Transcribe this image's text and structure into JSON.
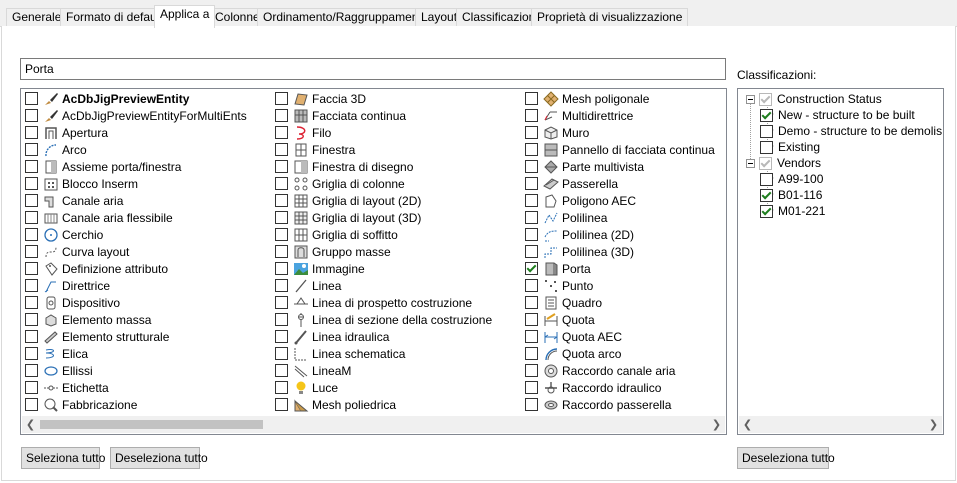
{
  "tabs": [
    {
      "label": "Generale"
    },
    {
      "label": "Formato di default"
    },
    {
      "label": "Applica a"
    },
    {
      "label": "Colonne"
    },
    {
      "label": "Ordinamento/Raggruppamento"
    },
    {
      "label": "Layout"
    },
    {
      "label": "Classificazioni"
    },
    {
      "label": "Proprietà di visualizzazione"
    }
  ],
  "active_tab": "Applica a",
  "search": {
    "value": "Porta"
  },
  "objects": {
    "col1": [
      {
        "label": "AcDbJigPreviewEntity",
        "icon": "brush-icon",
        "checked": false,
        "bold": true
      },
      {
        "label": "AcDbJigPreviewEntityForMultiEnts",
        "icon": "brush-icon",
        "checked": false
      },
      {
        "label": "Apertura",
        "icon": "opening-icon",
        "checked": false
      },
      {
        "label": "Arco",
        "icon": "arc-icon",
        "checked": false
      },
      {
        "label": "Assieme porta/finestra",
        "icon": "door-window-assembly-icon",
        "checked": false
      },
      {
        "label": "Blocco Inserm",
        "icon": "block-icon",
        "checked": false
      },
      {
        "label": "Canale aria",
        "icon": "duct-icon",
        "checked": false
      },
      {
        "label": "Canale aria flessibile",
        "icon": "flex-duct-icon",
        "checked": false
      },
      {
        "label": "Cerchio",
        "icon": "circle-icon",
        "checked": false
      },
      {
        "label": "Curva layout",
        "icon": "layout-curve-icon",
        "checked": false
      },
      {
        "label": "Definizione attributo",
        "icon": "attribute-icon",
        "checked": false
      },
      {
        "label": "Direttrice",
        "icon": "leader-icon",
        "checked": false
      },
      {
        "label": "Dispositivo",
        "icon": "device-icon",
        "checked": false
      },
      {
        "label": "Elemento massa",
        "icon": "mass-element-icon",
        "checked": false
      },
      {
        "label": "Elemento strutturale",
        "icon": "structural-member-icon",
        "checked": false
      },
      {
        "label": "Elica",
        "icon": "helix-icon",
        "checked": false
      },
      {
        "label": "Ellissi",
        "icon": "ellipse-icon",
        "checked": false
      },
      {
        "label": "Etichetta",
        "icon": "label-icon",
        "checked": false
      },
      {
        "label": "Fabbricazione",
        "icon": "fabrication-icon",
        "checked": false
      }
    ],
    "col2": [
      {
        "label": "Faccia 3D",
        "icon": "face3d-icon",
        "checked": false
      },
      {
        "label": "Facciata continua",
        "icon": "curtain-wall-icon",
        "checked": false
      },
      {
        "label": "Filo",
        "icon": "wire-icon",
        "checked": false
      },
      {
        "label": "Finestra",
        "icon": "window-icon",
        "checked": false
      },
      {
        "label": "Finestra di disegno",
        "icon": "viewport-icon",
        "checked": false
      },
      {
        "label": "Griglia di colonne",
        "icon": "column-grid-icon",
        "checked": false
      },
      {
        "label": "Griglia di layout (2D)",
        "icon": "layout-grid-icon",
        "checked": false
      },
      {
        "label": "Griglia di layout (3D)",
        "icon": "layout-grid-3d-icon",
        "checked": false
      },
      {
        "label": "Griglia di soffitto",
        "icon": "ceiling-grid-icon",
        "checked": false
      },
      {
        "label": "Gruppo masse",
        "icon": "mass-group-icon",
        "checked": false
      },
      {
        "label": "Immagine",
        "icon": "image-icon",
        "checked": false
      },
      {
        "label": "Linea",
        "icon": "line-icon",
        "checked": false
      },
      {
        "label": "Linea di prospetto costruzione",
        "icon": "elevation-line-icon",
        "checked": false
      },
      {
        "label": "Linea di sezione della costruzione",
        "icon": "section-line-icon",
        "checked": false
      },
      {
        "label": "Linea idraulica",
        "icon": "pipe-line-icon",
        "checked": false
      },
      {
        "label": "Linea schematica",
        "icon": "schematic-line-icon",
        "checked": false
      },
      {
        "label": "LineaM",
        "icon": "mline-icon",
        "checked": false
      },
      {
        "label": "Luce",
        "icon": "light-icon",
        "checked": false
      },
      {
        "label": "Mesh poliedrica",
        "icon": "polyface-mesh-icon",
        "checked": false
      }
    ],
    "col3": [
      {
        "label": "Mesh poligonale",
        "icon": "polygon-mesh-icon",
        "checked": false
      },
      {
        "label": "Multidirettrice",
        "icon": "multileader-icon",
        "checked": false
      },
      {
        "label": "Muro",
        "icon": "wall-icon",
        "checked": false
      },
      {
        "label": "Pannello di facciata continua",
        "icon": "curtain-panel-icon",
        "checked": false
      },
      {
        "label": "Parte multivista",
        "icon": "multiview-part-icon",
        "checked": false
      },
      {
        "label": "Passerella",
        "icon": "cable-tray-icon",
        "checked": false
      },
      {
        "label": "Poligono AEC",
        "icon": "aec-polygon-icon",
        "checked": false
      },
      {
        "label": "Polilinea",
        "icon": "polyline-icon",
        "checked": false
      },
      {
        "label": "Polilinea (2D)",
        "icon": "polyline-2d-icon",
        "checked": false
      },
      {
        "label": "Polilinea (3D)",
        "icon": "polyline-3d-icon",
        "checked": false
      },
      {
        "label": "Porta",
        "icon": "door-icon",
        "checked": true
      },
      {
        "label": "Punto",
        "icon": "point-icon",
        "checked": false
      },
      {
        "label": "Quadro",
        "icon": "panel-icon",
        "checked": false
      },
      {
        "label": "Quota",
        "icon": "dimension-icon",
        "checked": false
      },
      {
        "label": "Quota AEC",
        "icon": "aec-dimension-icon",
        "checked": false
      },
      {
        "label": "Quota arco",
        "icon": "arc-dimension-icon",
        "checked": false
      },
      {
        "label": "Raccordo canale aria",
        "icon": "duct-fitting-icon",
        "checked": false
      },
      {
        "label": "Raccordo idraulico",
        "icon": "pipe-fitting-icon",
        "checked": false
      },
      {
        "label": "Raccordo passerella",
        "icon": "tray-fitting-icon",
        "checked": false
      }
    ]
  },
  "classifications": {
    "label": "Classificazioni:",
    "tree": [
      {
        "label": "Construction Status",
        "level": 0,
        "checked": true,
        "grey": true,
        "expander": true
      },
      {
        "label": "New - structure to be built",
        "level": 1,
        "checked": true,
        "grey": false
      },
      {
        "label": "Demo - structure to be demolis",
        "level": 1,
        "checked": false,
        "grey": false
      },
      {
        "label": "Existing",
        "level": 1,
        "checked": false,
        "grey": false
      },
      {
        "label": "Vendors",
        "level": 0,
        "checked": true,
        "grey": true,
        "expander": true
      },
      {
        "label": "A99-100",
        "level": 1,
        "checked": false,
        "grey": false
      },
      {
        "label": "B01-116",
        "level": 1,
        "checked": true,
        "grey": false
      },
      {
        "label": "M01-221",
        "level": 1,
        "checked": true,
        "grey": false
      }
    ]
  },
  "buttons": {
    "select_all": "Seleziona tutto",
    "deselect_all": "Deseleziona tutto",
    "class_deselect_all": "Deseleziona tutto"
  },
  "colors": {
    "check": "#1e7e1e",
    "tab_bg": "#f0f0f0",
    "button_bg": "#e1e1e1"
  }
}
